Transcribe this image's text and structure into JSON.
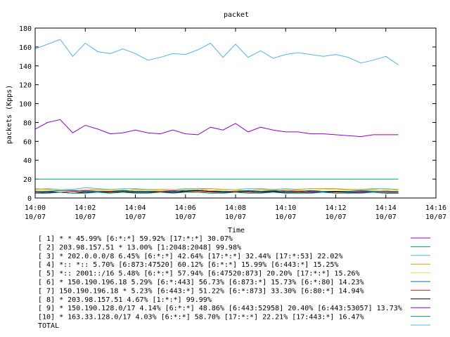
{
  "chart_data": {
    "type": "line",
    "title": "packet",
    "xlabel": "Time",
    "ylabel": "packets (Kpps)",
    "ylim": [
      0,
      180
    ],
    "yticks": [
      0,
      20,
      40,
      60,
      80,
      100,
      120,
      140,
      160,
      180
    ],
    "xlim": [
      "14:00",
      "14:16"
    ],
    "xticks": [
      {
        "time": "14:00",
        "date": "10/07"
      },
      {
        "time": "14:02",
        "date": "10/07"
      },
      {
        "time": "14:04",
        "date": "10/07"
      },
      {
        "time": "14:06",
        "date": "10/07"
      },
      {
        "time": "14:08",
        "date": "10/07"
      },
      {
        "time": "14:10",
        "date": "10/07"
      },
      {
        "time": "14:12",
        "date": "10/07"
      },
      {
        "time": "14:14",
        "date": "10/07"
      },
      {
        "time": "14:16",
        "date": "10/07"
      }
    ],
    "grid": false,
    "legend_position": "bottom",
    "x": [
      "14:00",
      "14:00:30",
      "14:01",
      "14:01:30",
      "14:02",
      "14:02:30",
      "14:03",
      "14:03:30",
      "14:04",
      "14:04:30",
      "14:05",
      "14:05:30",
      "14:06",
      "14:06:30",
      "14:07",
      "14:07:30",
      "14:08",
      "14:08:30",
      "14:09",
      "14:09:30",
      "14:10",
      "14:10:30",
      "14:11",
      "14:11:30",
      "14:12",
      "14:12:30",
      "14:13",
      "14:13:30",
      "14:14",
      "14:14:30"
    ],
    "series": [
      {
        "name": "[ 1] * * 45.99%  [6:*:*] 59.92% [17:*:*] 30.07%",
        "color": "#9400d3",
        "values": [
          7,
          7,
          6,
          7,
          8,
          7,
          7,
          8,
          7,
          7,
          7,
          8,
          7,
          9,
          8,
          7,
          7,
          8,
          7,
          7,
          8,
          8,
          7,
          7,
          7,
          6,
          7,
          7,
          7,
          6
        ]
      },
      {
        "name": "[ 2] 203.98.157.51 * 13.00%  [1:2048:2048] 99.98%",
        "color": "#009e73",
        "values": [
          20,
          20,
          20,
          20,
          20,
          20,
          20,
          20,
          20,
          20,
          20,
          20,
          20,
          20,
          20,
          20,
          20,
          20,
          20,
          20,
          20,
          20,
          20,
          20,
          20,
          20,
          20,
          20,
          20,
          20
        ]
      },
      {
        "name": "[ 3] * 202.0.0.0/8 6.45%  [6:*:*] 42.64% [17:*:*] 32.44% [17:*:53] 22.02%",
        "color": "#56b4e9",
        "values": [
          9,
          10,
          9,
          9,
          11,
          10,
          9,
          10,
          10,
          9,
          9,
          9,
          10,
          10,
          10,
          9,
          9,
          10,
          10,
          9,
          10,
          9,
          10,
          10,
          9,
          9,
          9,
          10,
          10,
          9
        ]
      },
      {
        "name": "[ 4] *:: *:: 5.70%  [6:873:47520] 60.12% [6:*:*] 15.99% [6:443:*] 15.25%",
        "color": "#e69f00",
        "values": [
          10,
          9,
          8,
          8,
          9,
          9,
          8,
          8,
          9,
          8,
          9,
          9,
          8,
          9,
          10,
          9,
          8,
          8,
          9,
          9,
          8,
          9,
          10,
          10,
          10,
          9,
          9,
          9,
          8,
          9
        ]
      },
      {
        "name": "[ 5] *:: 2001::/16 5.48%  [6:*:*] 57.94% [6:47520:873] 20.20% [17:*:*] 15.26%",
        "color": "#f0e442",
        "values": [
          8,
          8,
          9,
          8,
          9,
          8,
          8,
          9,
          8,
          8,
          8,
          9,
          9,
          9,
          8,
          8,
          9,
          8,
          8,
          8,
          9,
          8,
          8,
          9,
          9,
          8,
          8,
          8,
          9,
          8
        ]
      },
      {
        "name": "[ 6] * 150.190.196.18 5.29%  [6:*:443] 56.73% [6:873:*] 15.73% [6:*:80] 14.23%",
        "color": "#0072b2",
        "values": [
          7,
          7,
          8,
          8,
          7,
          7,
          7,
          8,
          7,
          7,
          7,
          7,
          8,
          8,
          7,
          7,
          7,
          8,
          7,
          8,
          7,
          7,
          8,
          7,
          7,
          7,
          8,
          7,
          7,
          7
        ]
      },
      {
        "name": "[ 7] 150.190.196.18 * 5.23%  [6:443:*] 51.22% [6:*:873] 33.30% [6:80:*] 14.94%",
        "color": "#e51e10",
        "values": [
          6,
          6,
          6,
          7,
          6,
          6,
          7,
          6,
          6,
          6,
          7,
          6,
          6,
          7,
          6,
          6,
          7,
          6,
          6,
          6,
          6,
          7,
          6,
          6,
          6,
          6,
          6,
          6,
          6,
          6
        ]
      },
      {
        "name": "[ 8] * 203.98.157.51 4.67%  [1:*:*] 99.99%",
        "color": "#000000",
        "values": [
          5,
          6,
          6,
          5,
          6,
          6,
          6,
          7,
          6,
          6,
          6,
          6,
          7,
          8,
          7,
          6,
          6,
          7,
          6,
          7,
          6,
          6,
          6,
          6,
          7,
          6,
          6,
          6,
          5,
          5
        ]
      },
      {
        "name": "[ 9] * 150.190.128.0/17 4.14%  [6:*:*] 48.86% [6:443:52958] 20.40% [6:443:53057] 13.73%",
        "color": "#9400d3",
        "values": [
          73,
          80,
          83,
          69,
          77,
          73,
          68,
          69,
          72,
          69,
          68,
          72,
          68,
          67,
          75,
          72,
          79,
          70,
          75,
          72,
          70,
          70,
          68,
          68,
          67,
          66,
          65,
          67,
          67,
          67
        ]
      },
      {
        "name": "[10] * 163.33.128.0/17 4.03%  [6:*:*] 58.70% [17:*:*] 22.21% [17:443:*] 16.47%",
        "color": "#009e73",
        "values": [
          5,
          5,
          6,
          5,
          5,
          6,
          5,
          6,
          5,
          5,
          6,
          5,
          6,
          6,
          5,
          5,
          6,
          5,
          5,
          6,
          5,
          5,
          5,
          6,
          5,
          5,
          5,
          6,
          5,
          5
        ]
      },
      {
        "name": "TOTAL",
        "color": "#56b4e9",
        "values": [
          158,
          163,
          168,
          150,
          164,
          155,
          153,
          158,
          153,
          146,
          149,
          153,
          152,
          157,
          164,
          149,
          163,
          149,
          156,
          148,
          152,
          154,
          152,
          150,
          152,
          149,
          143,
          146,
          150,
          141
        ]
      }
    ]
  }
}
